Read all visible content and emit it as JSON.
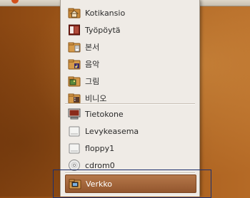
{
  "places_menu": {
    "items": [
      {
        "label": "Kotikansio",
        "icon": "home-folder-icon"
      },
      {
        "label": "Työpöytä",
        "icon": "desktop-icon"
      },
      {
        "label": "본서",
        "icon": "documents-folder-icon"
      },
      {
        "label": "음악",
        "icon": "music-folder-icon"
      },
      {
        "label": "그림",
        "icon": "pictures-folder-icon"
      },
      {
        "label": "비니오",
        "icon": "videos-folder-icon"
      },
      {
        "label": "Tietokone",
        "icon": "computer-icon"
      },
      {
        "label": "Levykeasema",
        "icon": "floppy-drive-icon"
      },
      {
        "label": "floppy1",
        "icon": "floppy-drive-icon"
      },
      {
        "label": "cdrom0",
        "icon": "cdrom-icon"
      },
      {
        "label": "Verkko",
        "icon": "network-folder-icon"
      }
    ],
    "selected_item": "Verkko"
  },
  "colors": {
    "menu_background": "#efebe6",
    "selection": "#a86a3e",
    "desktop": "#a35a1a",
    "highlight_box": "#1c2f6e"
  }
}
